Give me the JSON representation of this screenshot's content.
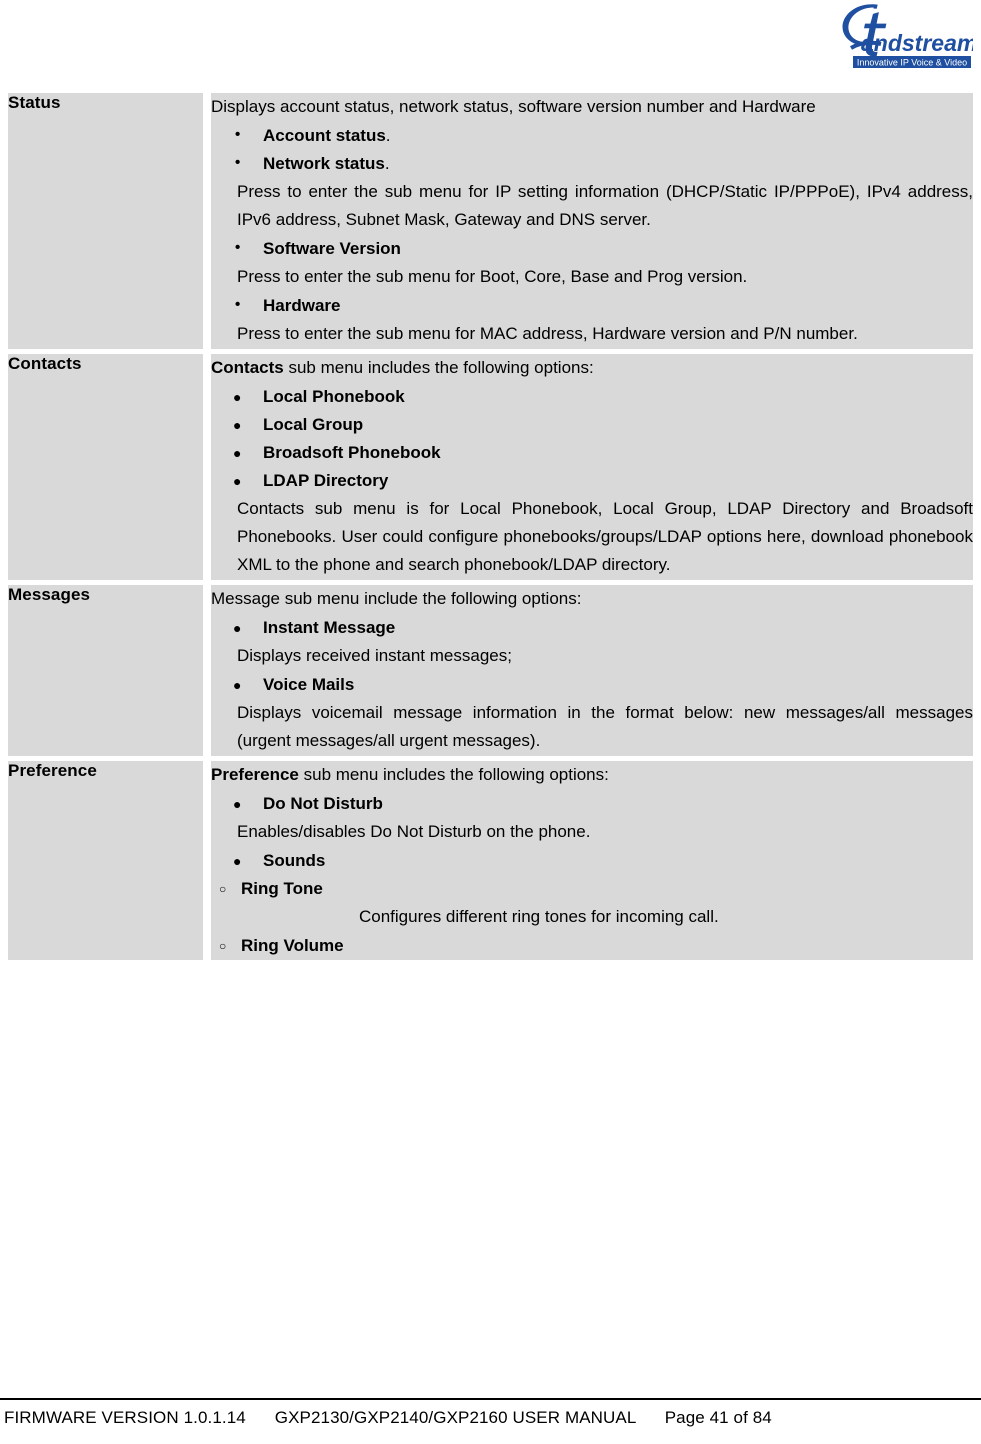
{
  "header": {
    "logo_name": "Grandstream",
    "logo_tagline": "Innovative IP Voice & Video"
  },
  "table": {
    "rows": [
      {
        "label": "Status",
        "lead": "Displays account status, network status, software version number and Hardware",
        "bullet_style": "dot",
        "items": [
          {
            "title": "Account status",
            "title_tail": ".",
            "note": ""
          },
          {
            "title": "Network status",
            "title_tail": ".",
            "note": "Press to enter the sub menu for IP setting information (DHCP/Static IP/PPPoE), IPv4 address, IPv6 address, Subnet Mask, Gateway and DNS server."
          },
          {
            "title": "Software Version",
            "title_tail": "",
            "note": "Press to enter the sub menu for Boot, Core, Base and Prog version."
          },
          {
            "title": "Hardware",
            "title_tail": "",
            "note": "Press to enter the sub menu for MAC address, Hardware version and P/N number."
          }
        ],
        "trailing": ""
      },
      {
        "label": "Contacts",
        "lead_bold": "Contacts",
        "lead_rest": " sub menu includes the following options:",
        "bullet_style": "disc",
        "items": [
          {
            "title": "Local Phonebook",
            "title_tail": "",
            "note": ""
          },
          {
            "title": "Local Group",
            "title_tail": "",
            "note": ""
          },
          {
            "title": "Broadsoft Phonebook",
            "title_tail": "",
            "note": ""
          },
          {
            "title": "LDAP Directory",
            "title_tail": "",
            "note": ""
          }
        ],
        "trailing": "Contacts sub menu is for Local Phonebook, Local Group, LDAP Directory and Broadsoft Phonebooks. User could configure phonebooks/groups/LDAP options here, download phonebook XML to the phone and search phonebook/LDAP directory."
      },
      {
        "label": "Messages",
        "lead": "Message sub menu include the following options:",
        "bullet_style": "disc",
        "items": [
          {
            "title": "Instant Message",
            "title_tail": "",
            "note": "Displays received instant messages;"
          },
          {
            "title": "Voice Mails",
            "title_tail": "",
            "note": "Displays voicemail message information in the format below: new messages/all messages (urgent messages/all urgent messages)."
          }
        ],
        "trailing": ""
      },
      {
        "label": "Preference",
        "lead_bold": "Preference",
        "lead_rest": " sub menu includes the following options:",
        "bullet_style": "disc",
        "items": [
          {
            "title": "Do Not Disturb",
            "title_tail": "",
            "note": "Enables/disables Do Not Disturb on the phone."
          },
          {
            "title": "Sounds",
            "title_tail": "",
            "note": ""
          }
        ],
        "sub_items": [
          {
            "title": "Ring Tone",
            "note": "Configures different ring tones for incoming call."
          },
          {
            "title": "Ring Volume",
            "note": ""
          }
        ],
        "trailing": ""
      }
    ]
  },
  "footer": {
    "firmware": "FIRMWARE VERSION 1.0.1.14",
    "manual": "GXP2130/GXP2140/GXP2160 USER MANUAL",
    "page": "Page 41 of 84",
    "full": "FIRMWARE VERSION 1.0.1.14      GXP2130/GXP2140/GXP2160 USER MANUAL      Page 41 of 84"
  }
}
